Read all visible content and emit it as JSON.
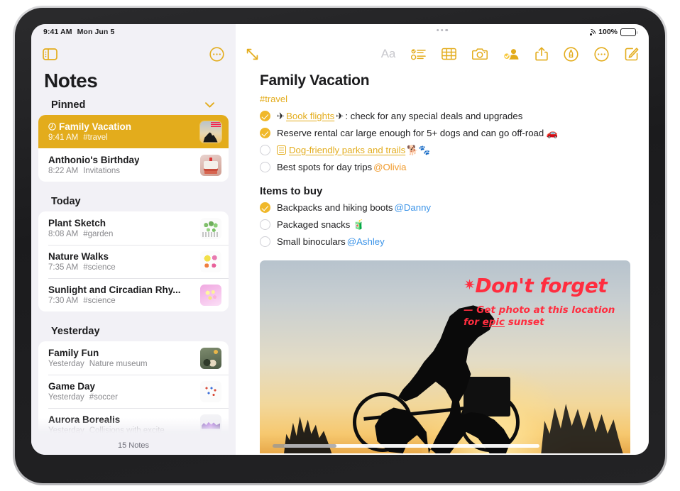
{
  "status_bar": {
    "time": "9:41 AM",
    "date": "Mon Jun 5",
    "battery_percent": "100%",
    "wifi_icon": "wifi-icon",
    "battery_icon": "battery-icon"
  },
  "sidebar": {
    "toggle_icon": "sidebar-toggle-icon",
    "more_icon": "ellipsis-circle-icon",
    "title": "Notes",
    "footer_count": "15 Notes",
    "sections": [
      {
        "header": "Pinned",
        "collapse_icon": "chevron-down-icon",
        "collapsible": true,
        "notes": [
          {
            "title": "Family Vacation",
            "time": "9:41 AM",
            "detail": "#travel",
            "pinned": true,
            "selected": true,
            "thumb": "th-bike"
          },
          {
            "title": "Anthonio's Birthday",
            "time": "8:22 AM",
            "detail": "Invitations",
            "pinned": false,
            "selected": false,
            "thumb": "th-cake"
          }
        ]
      },
      {
        "header": "Today",
        "collapsible": false,
        "notes": [
          {
            "title": "Plant Sketch",
            "time": "8:08 AM",
            "detail": "#garden",
            "pinned": false,
            "selected": false,
            "thumb": "th-plant"
          },
          {
            "title": "Nature Walks",
            "time": "7:35 AM",
            "detail": "#science",
            "pinned": false,
            "selected": false,
            "thumb": "th-nature"
          },
          {
            "title": "Sunlight and Circadian Rhy...",
            "time": "7:30 AM",
            "detail": "#science",
            "pinned": false,
            "selected": false,
            "thumb": "th-sun"
          }
        ]
      },
      {
        "header": "Yesterday",
        "collapsible": false,
        "notes": [
          {
            "title": "Family Fun",
            "time": "Yesterday",
            "detail": "Nature museum",
            "pinned": false,
            "selected": false,
            "thumb": "th-museum"
          },
          {
            "title": "Game Day",
            "time": "Yesterday",
            "detail": "#soccer",
            "pinned": false,
            "selected": false,
            "thumb": "th-game"
          },
          {
            "title": "Aurora Borealis",
            "time": "Yesterday",
            "detail": "Collisions with excite",
            "pinned": false,
            "selected": false,
            "thumb": "th-aurora"
          }
        ]
      }
    ]
  },
  "detail": {
    "expand_icon": "expand-diagonal-icon",
    "drag_handle": "window-drag-handle",
    "toolbar": [
      {
        "name": "format-text-button",
        "label": "Aa",
        "disabled": true
      },
      {
        "name": "checklist-button",
        "label": "",
        "disabled": false
      },
      {
        "name": "table-button",
        "label": "",
        "disabled": false
      },
      {
        "name": "camera-button",
        "label": "",
        "disabled": false
      },
      {
        "name": "collaborate-button",
        "label": "",
        "disabled": false
      },
      {
        "name": "share-button",
        "label": "",
        "disabled": false
      },
      {
        "name": "markup-pen-button",
        "label": "",
        "disabled": false
      },
      {
        "name": "more-options-button",
        "label": "",
        "disabled": false
      },
      {
        "name": "compose-note-button",
        "label": "",
        "disabled": false
      }
    ],
    "note": {
      "title": "Family Vacation",
      "tag": "#travel",
      "checklist": [
        {
          "checked": true,
          "prefix_emoji": "✈",
          "link_text": "Book flights",
          "suffix_emoji": "✈",
          "text": ": check for any special deals and upgrades",
          "mention": "",
          "doc_icon": false
        },
        {
          "checked": true,
          "prefix_emoji": "",
          "link_text": "",
          "suffix_emoji": "",
          "text": "Reserve rental car large enough for 5+ dogs and can go off-road 🚗",
          "mention": "",
          "doc_icon": false
        },
        {
          "checked": false,
          "prefix_emoji": "",
          "link_text": "Dog-friendly parks and trails",
          "suffix_emoji": "🐕🐾",
          "text": "",
          "mention": "",
          "doc_icon": true
        },
        {
          "checked": false,
          "prefix_emoji": "",
          "link_text": "",
          "suffix_emoji": "",
          "text": "Best spots for day trips ",
          "mention": "@Olivia",
          "mention_color": "orange",
          "doc_icon": false
        }
      ],
      "subheading": "Items to buy",
      "buy_list": [
        {
          "checked": true,
          "text": "Backpacks and hiking boots ",
          "mention": "@Danny",
          "mention_color": "blue"
        },
        {
          "checked": false,
          "text": "Packaged snacks 🧃",
          "mention": "",
          "mention_color": ""
        },
        {
          "checked": false,
          "text": "Small binoculars ",
          "mention": "@Ashley",
          "mention_color": "blue"
        }
      ],
      "photo": {
        "name": "cyclist-sunset-photo",
        "annotation_star": "✷",
        "annotation_line1": "Don't forget",
        "annotation_line2a": "— Get photo at this location",
        "annotation_line2b_pre": "for ",
        "annotation_line2b_underlined": "epic",
        "annotation_line2b_post": " sunset"
      }
    }
  },
  "colors": {
    "accent": "#e3ac1c",
    "selected_row": "#e3ac1c",
    "checkbox_filled": "#f0b82a",
    "mention_blue": "#3a93e8",
    "mention_orange": "#f09a2b",
    "annotation_red": "#ff2d3f",
    "sidebar_bg": "#f2f1f6"
  }
}
